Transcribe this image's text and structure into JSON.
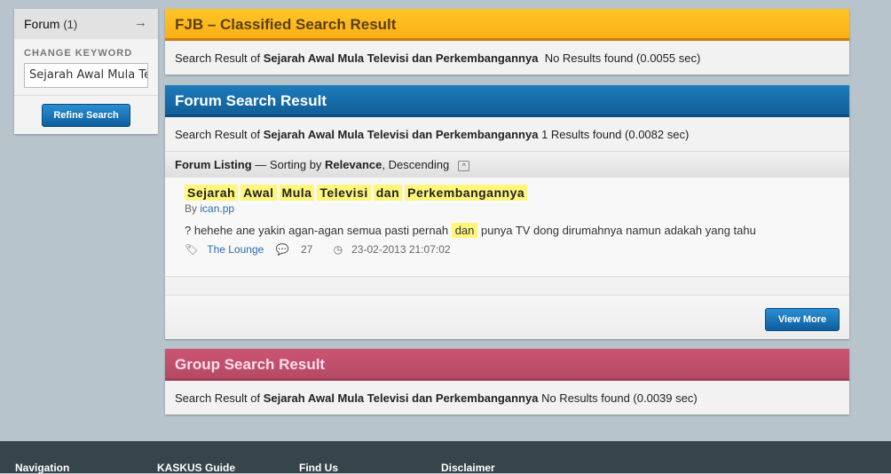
{
  "sidebar": {
    "title": "Forum",
    "count": "(1)",
    "change_label": "CHANGE KEYWORD",
    "keyword": "Sejarah Awal Mula Televisi dan Perkembangannya",
    "refine": "Refine Search"
  },
  "fjb": {
    "title": "FJB – Classified Search Result",
    "prefix": "Search Result of",
    "keyword": "Sejarah Awal Mula Televisi dan Perkembangannya",
    "status": "No Results found (0.0055 sec)"
  },
  "forum": {
    "title": "Forum Search Result",
    "prefix": "Search Result of",
    "keyword": "Sejarah Awal Mula Televisi dan Perkembangannya",
    "status": "1 Results found (0.0082 sec)",
    "listing": {
      "label": "Forum Listing",
      "sep": " — Sorting by ",
      "sort": "Relevance",
      "order": ", Descending"
    },
    "results": [
      {
        "title_words": [
          "Sejarah",
          "Awal",
          "Mula",
          "Televisi",
          "dan",
          "Perkembangannya"
        ],
        "by": "By",
        "author": "ican.pp",
        "excerpt_before": "? hehehe ane yakin agan-agan semua pasti pernah",
        "excerpt_hl": "dan",
        "excerpt_after": "punya TV dong dirumahnya namun adakah yang tahu",
        "category": "The Lounge",
        "replies": "27",
        "date": "23-02-2013 21:07:02"
      }
    ],
    "view_more": "View More"
  },
  "group": {
    "title": "Group Search Result",
    "prefix": "Search Result of",
    "keyword": "Sejarah Awal Mula Televisi dan Perkembangannya",
    "status": "No Results found (0.0039 sec)"
  },
  "footer": {
    "cols": [
      "Navigation",
      "KASKUS Guide",
      "Find Us",
      "Disclaimer"
    ]
  }
}
